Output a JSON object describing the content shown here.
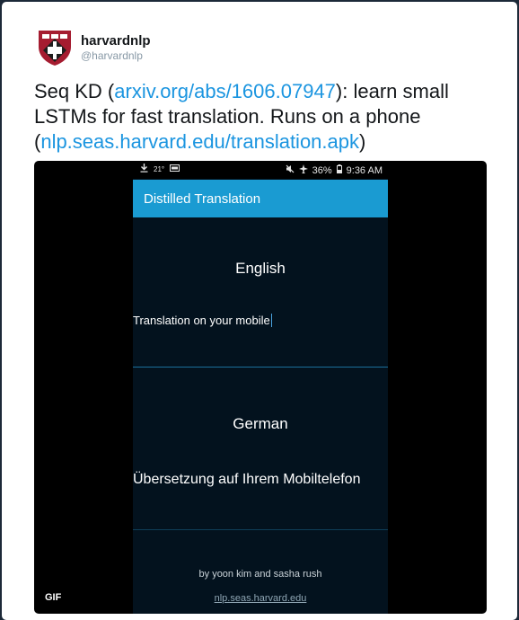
{
  "user": {
    "name": "harvardnlp",
    "handle": "@harvardnlp"
  },
  "tweet": {
    "text_1": "Seq KD (",
    "link_1": "arxiv.org/abs/1606.07947",
    "text_2": "): learn small LSTMs for fast translation. Runs on a phone (",
    "link_2": "nlp.seas.harvard.edu/translation.apk",
    "text_3": ")"
  },
  "phone": {
    "status": {
      "left_small": "21°",
      "battery": "36%",
      "time": "9:36 AM"
    },
    "app_title": "Distilled Translation",
    "source_lang": "English",
    "source_text": "Translation on your mobile",
    "target_lang": "German",
    "target_text": "Übersetzung auf Ihrem Mobiltelefon",
    "credit": "by yoon kim and sasha rush",
    "site": "nlp.seas.harvard.edu"
  },
  "media": {
    "badge": "GIF"
  },
  "colors": {
    "link": "#1b95e0",
    "appbar": "#1a9bd2",
    "screen": "#03121e",
    "divider": "#1a6f9a"
  }
}
